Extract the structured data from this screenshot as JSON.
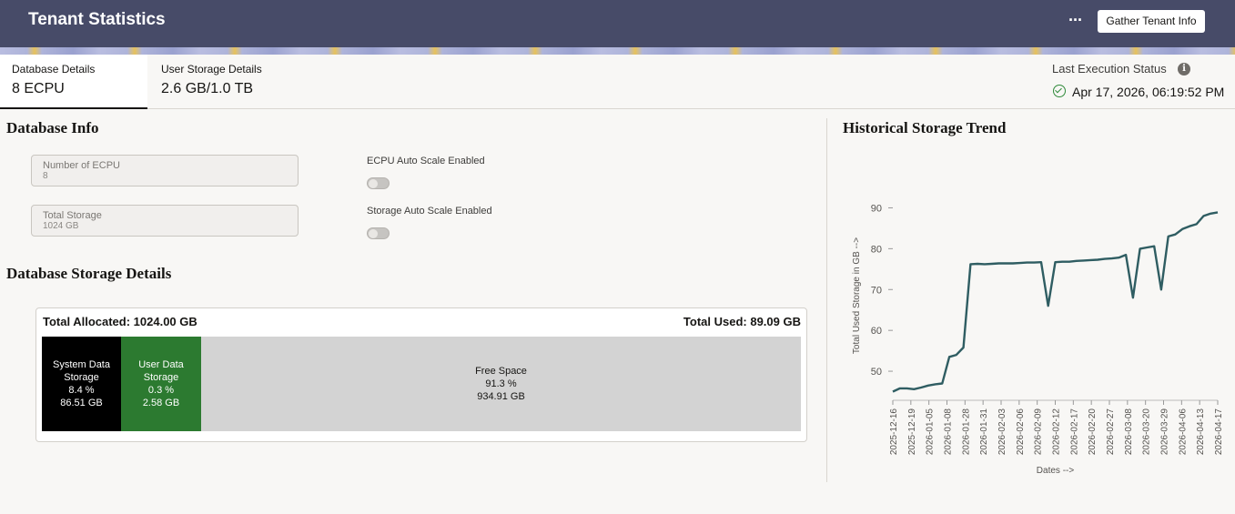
{
  "header": {
    "title": "Tenant Statistics",
    "more_label": "···",
    "gather_button": "Gather Tenant Info"
  },
  "tabs": [
    {
      "label": "Database Details",
      "value": "8 ECPU"
    },
    {
      "label": "User Storage Details",
      "value": "2.6 GB/1.0 TB"
    }
  ],
  "last_execution": {
    "label": "Last Execution Status",
    "info_icon": "i",
    "timestamp": "Apr 17, 2026, 06:19:52 PM",
    "status_color": "#2f8a3a"
  },
  "database_info": {
    "heading": "Database Info",
    "fields": [
      {
        "label": "Number of ECPU",
        "value": "8"
      },
      {
        "label": "Total Storage",
        "value": "1024 GB"
      }
    ],
    "toggles": [
      {
        "label": "ECPU Auto Scale Enabled",
        "enabled": false
      },
      {
        "label": "Storage Auto Scale Enabled",
        "enabled": false
      }
    ]
  },
  "storage_details": {
    "heading": "Database Storage Details",
    "total_allocated": "Total Allocated: 1024.00 GB",
    "total_used": "Total Used: 89.09 GB",
    "segments": [
      {
        "name": "System Data",
        "name2": "Storage",
        "percent": "8.4 %",
        "size": "86.51 GB",
        "color": "#000000"
      },
      {
        "name": "User Data",
        "name2": "Storage",
        "percent": "0.3 %",
        "size": "2.58 GB",
        "color": "#2c7a30"
      },
      {
        "name": "Free Space",
        "percent": "91.3 %",
        "size": "934.91 GB",
        "color": "#d3d3d3"
      }
    ]
  },
  "trend": {
    "heading": "Historical Storage Trend"
  },
  "chart_data": {
    "type": "line",
    "title": "Historical Storage Trend",
    "xlabel": "Dates -->",
    "ylabel": "Total Used Storage in GB -->",
    "yticks": [
      50,
      60,
      70,
      80,
      90
    ],
    "ylim": [
      44,
      93
    ],
    "grid": false,
    "line_color": "#2f5d62",
    "x_ticks": [
      "2025-12-16",
      "2025-12-19",
      "2026-01-05",
      "2026-01-08",
      "2026-01-28",
      "2026-01-31",
      "2026-02-03",
      "2026-02-06",
      "2026-02-09",
      "2026-02-12",
      "2026-02-17",
      "2026-02-20",
      "2026-02-27",
      "2026-03-08",
      "2026-03-20",
      "2026-03-29",
      "2026-04-06",
      "2026-04-13",
      "2026-04-17"
    ],
    "series": [
      {
        "values": [
          45.0,
          45.8,
          45.8,
          45.6,
          46.0,
          46.5,
          46.8,
          47.0,
          53.5,
          54.0,
          55.8,
          76.2,
          76.3,
          76.2,
          76.3,
          76.4,
          76.4,
          76.4,
          76.5,
          76.6,
          76.6,
          76.7,
          66.0,
          76.7,
          76.8,
          76.8,
          77.0,
          77.1,
          77.2,
          77.3,
          77.5,
          77.6,
          77.8,
          78.5,
          68.0,
          80.0,
          80.3,
          80.6,
          70.0,
          83.0,
          83.5,
          84.8,
          85.5,
          86.0,
          88.0,
          88.6,
          88.9
        ]
      }
    ]
  }
}
